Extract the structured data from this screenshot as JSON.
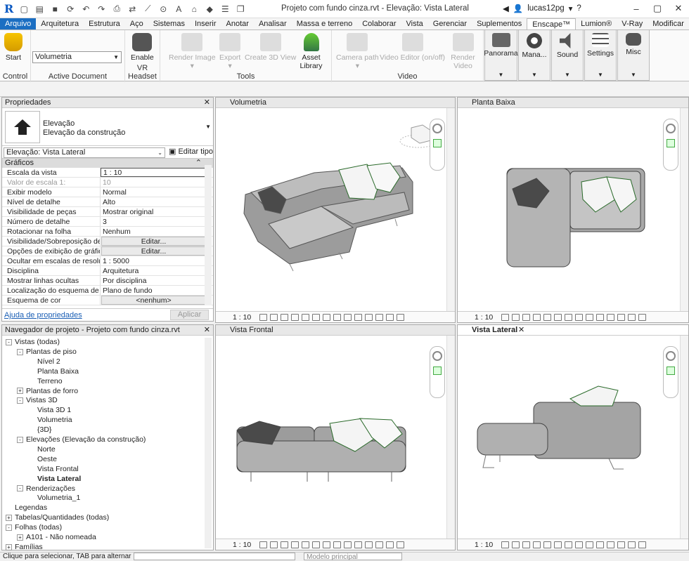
{
  "window": {
    "title": "Projeto com fundo cinza.rvt - Elevação: Vista Lateral",
    "user": "lucas12pg",
    "app_logo": "R"
  },
  "menu_tabs": [
    "Arquivo",
    "Arquitetura",
    "Estrutura",
    "Aço",
    "Sistemas",
    "Inserir",
    "Anotar",
    "Analisar",
    "Massa e terreno",
    "Colaborar",
    "Vista",
    "Gerenciar",
    "Suplementos",
    "Enscape™",
    "Lumion®",
    "V-Ray",
    "Modificar"
  ],
  "active_tab": "Enscape™",
  "ribbon": {
    "control": {
      "label": "Control",
      "start": "Start"
    },
    "active_document": {
      "label": "Active Document",
      "dropdown": "Volumetria"
    },
    "vr": {
      "label": "VR Headset",
      "enable": "Enable"
    },
    "tools": {
      "label": "Tools",
      "render": "Render Image",
      "export": "Export",
      "create3d": "Create 3D View",
      "asset": "Asset Library"
    },
    "video": {
      "label": "Video",
      "camera": "Camera path",
      "editor": "Video Editor (on/off)",
      "render": "Render Video"
    },
    "panorama": "Panorama",
    "manage": "Mana...",
    "sound": "Sound",
    "settings": "Settings",
    "misc": "Misc"
  },
  "properties": {
    "title": "Propriedades",
    "type_line1": "Elevação",
    "type_line2": "Elevação da construção",
    "selector": "Elevação: Vista Lateral",
    "edit_type": "Editar tipo",
    "section": "Gráficos",
    "rows": [
      {
        "k": "Escala da vista",
        "v": "1 : 10"
      },
      {
        "k": "Valor de escala    1:",
        "v": "10"
      },
      {
        "k": "Exibir modelo",
        "v": "Normal"
      },
      {
        "k": "Nível de detalhe",
        "v": "Alto"
      },
      {
        "k": "Visibilidade de peças",
        "v": "Mostrar original"
      },
      {
        "k": "Número de detalhe",
        "v": "3"
      },
      {
        "k": "Rotacionar na folha",
        "v": "Nenhum"
      },
      {
        "k": "Visibilidade/Sobreposição de ...",
        "v": "Editar..."
      },
      {
        "k": "Opções de exibição de gráficos",
        "v": "Editar..."
      },
      {
        "k": "Ocultar em escalas de resoluç...",
        "v": "1 : 5000"
      },
      {
        "k": "Disciplina",
        "v": "Arquitetura"
      },
      {
        "k": "Mostrar linhas ocultas",
        "v": "Por disciplina"
      },
      {
        "k": "Localização do esquema de cor",
        "v": "Plano de fundo"
      },
      {
        "k": "Esquema de cor",
        "v": "<nenhum>"
      }
    ],
    "help": "Ajuda de propriedades",
    "apply": "Aplicar"
  },
  "browser": {
    "title": "Navegador de projeto - Projeto com fundo cinza.rvt",
    "nodes": [
      {
        "t": "Vistas (todas)",
        "lvl": 0,
        "exp": "-"
      },
      {
        "t": "Plantas de piso",
        "lvl": 1,
        "exp": "-"
      },
      {
        "t": "Nível 2",
        "lvl": 2
      },
      {
        "t": "Planta Baixa",
        "lvl": 2
      },
      {
        "t": "Terreno",
        "lvl": 2
      },
      {
        "t": "Plantas de forro",
        "lvl": 1,
        "exp": "+"
      },
      {
        "t": "Vistas 3D",
        "lvl": 1,
        "exp": "-"
      },
      {
        "t": "Vista 3D 1",
        "lvl": 2
      },
      {
        "t": "Volumetria",
        "lvl": 2
      },
      {
        "t": "{3D}",
        "lvl": 2
      },
      {
        "t": "Elevações (Elevação da construção)",
        "lvl": 1,
        "exp": "-"
      },
      {
        "t": "Norte",
        "lvl": 2
      },
      {
        "t": "Oeste",
        "lvl": 2
      },
      {
        "t": "Vista Frontal",
        "lvl": 2
      },
      {
        "t": "Vista Lateral",
        "lvl": 2,
        "bold": true
      },
      {
        "t": "Renderizações",
        "lvl": 1,
        "exp": "-"
      },
      {
        "t": "Volumetria_1",
        "lvl": 2
      },
      {
        "t": "Legendas",
        "lvl": 0
      },
      {
        "t": "Tabelas/Quantidades (todas)",
        "lvl": 0,
        "exp": "+"
      },
      {
        "t": "Folhas (todas)",
        "lvl": 0,
        "exp": "-"
      },
      {
        "t": "A101 - Não nomeada",
        "lvl": 1,
        "exp": "+"
      },
      {
        "t": "Famílias",
        "lvl": 0,
        "exp": "+"
      }
    ]
  },
  "views": {
    "v1": {
      "tab": "Volumetria",
      "scale": "1 : 10"
    },
    "v2": {
      "tab": "Planta Baixa",
      "scale": "1 : 10"
    },
    "v3": {
      "tab": "Vista Frontal",
      "scale": "1 : 10"
    },
    "v4": {
      "tab": "Vista Lateral",
      "scale": "1 : 10"
    }
  },
  "status": {
    "text": "Clique para selecionar, TAB para alternar",
    "model": "Modelo principal"
  },
  "colors": {
    "accent": "#1b6ec2",
    "sofa": "#9a9a9a",
    "pillow_dark": "#4a4a4a"
  }
}
